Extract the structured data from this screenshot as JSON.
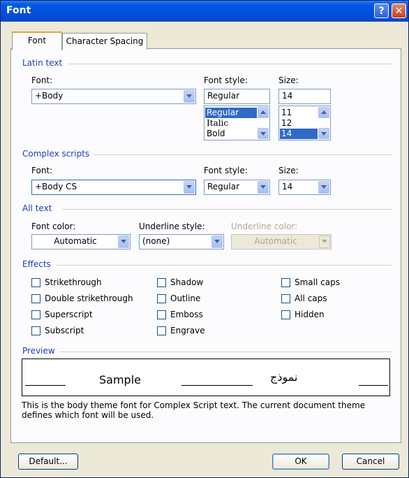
{
  "window": {
    "title": "Font"
  },
  "titlebar": {
    "help": "?",
    "close": "✕"
  },
  "tabs": [
    {
      "label": "Font",
      "accel": "n"
    },
    {
      "label": "Character Spacing",
      "accel": "r"
    }
  ],
  "latin": {
    "group": "Latin text",
    "font_label": "Font:",
    "font_value": "+Body",
    "style_label": "Font style:",
    "style_value": "Regular",
    "style_options": [
      "Regular",
      "Italic",
      "Bold"
    ],
    "size_label": "Size:",
    "size_value": "14",
    "size_options": [
      "11",
      "12",
      "14"
    ]
  },
  "complex": {
    "group": "Complex scripts",
    "font_label": "Font:",
    "font_value": "+Body CS",
    "style_label": "Font style:",
    "style_value": "Regular",
    "size_label": "Size:",
    "size_value": "14"
  },
  "alltext": {
    "group": "All text",
    "color_label": "Font color:",
    "color_value": "Automatic",
    "underline_label": "Underline style:",
    "underline_value": "(none)",
    "ucolor_label": "Underline color:",
    "ucolor_value": "Automatic"
  },
  "effects": {
    "group": "Effects",
    "items": [
      "Strikethrough",
      "Double strikethrough",
      "Superscript",
      "Subscript",
      "Shadow",
      "Outline",
      "Emboss",
      "Engrave",
      "Small caps",
      "All caps",
      "Hidden"
    ]
  },
  "preview": {
    "group": "Preview",
    "sample": "Sample",
    "arabic": "نموذج",
    "description": "This is the body theme font for Complex Script text. The current document theme defines which font will be used."
  },
  "buttons": {
    "default": "Default...",
    "ok": "OK",
    "cancel": "Cancel"
  }
}
